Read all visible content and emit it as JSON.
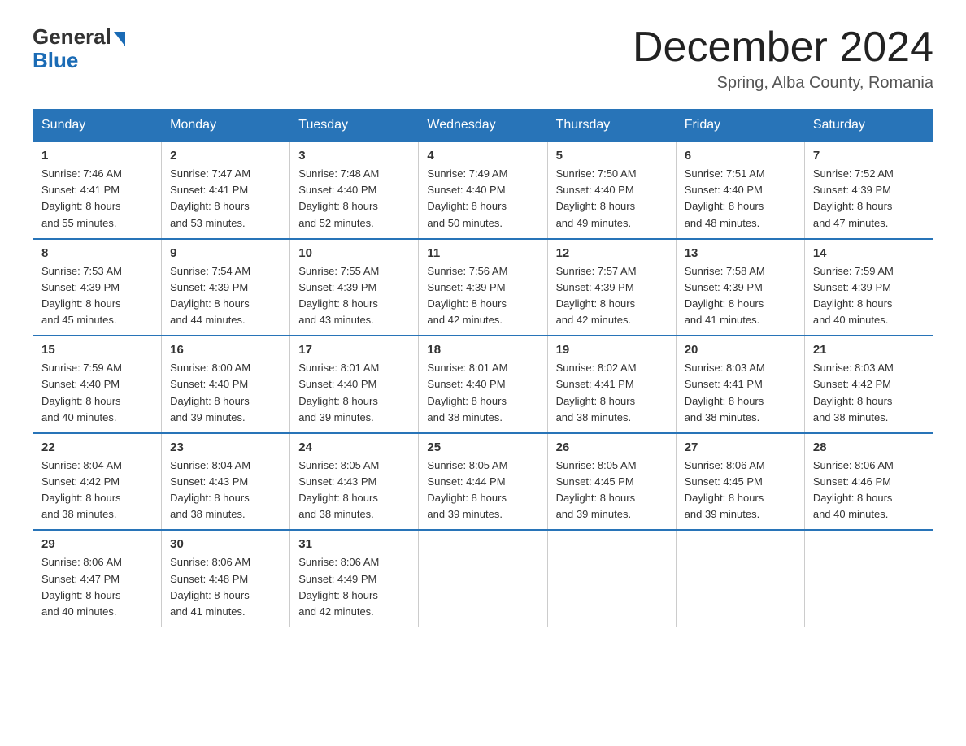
{
  "header": {
    "logo_general": "General",
    "logo_blue": "Blue",
    "month_title": "December 2024",
    "location": "Spring, Alba County, Romania"
  },
  "weekdays": [
    "Sunday",
    "Monday",
    "Tuesday",
    "Wednesday",
    "Thursday",
    "Friday",
    "Saturday"
  ],
  "weeks": [
    [
      {
        "day": "1",
        "sunrise": "7:46 AM",
        "sunset": "4:41 PM",
        "daylight": "8 hours and 55 minutes."
      },
      {
        "day": "2",
        "sunrise": "7:47 AM",
        "sunset": "4:41 PM",
        "daylight": "8 hours and 53 minutes."
      },
      {
        "day": "3",
        "sunrise": "7:48 AM",
        "sunset": "4:40 PM",
        "daylight": "8 hours and 52 minutes."
      },
      {
        "day": "4",
        "sunrise": "7:49 AM",
        "sunset": "4:40 PM",
        "daylight": "8 hours and 50 minutes."
      },
      {
        "day": "5",
        "sunrise": "7:50 AM",
        "sunset": "4:40 PM",
        "daylight": "8 hours and 49 minutes."
      },
      {
        "day": "6",
        "sunrise": "7:51 AM",
        "sunset": "4:40 PM",
        "daylight": "8 hours and 48 minutes."
      },
      {
        "day": "7",
        "sunrise": "7:52 AM",
        "sunset": "4:39 PM",
        "daylight": "8 hours and 47 minutes."
      }
    ],
    [
      {
        "day": "8",
        "sunrise": "7:53 AM",
        "sunset": "4:39 PM",
        "daylight": "8 hours and 45 minutes."
      },
      {
        "day": "9",
        "sunrise": "7:54 AM",
        "sunset": "4:39 PM",
        "daylight": "8 hours and 44 minutes."
      },
      {
        "day": "10",
        "sunrise": "7:55 AM",
        "sunset": "4:39 PM",
        "daylight": "8 hours and 43 minutes."
      },
      {
        "day": "11",
        "sunrise": "7:56 AM",
        "sunset": "4:39 PM",
        "daylight": "8 hours and 42 minutes."
      },
      {
        "day": "12",
        "sunrise": "7:57 AM",
        "sunset": "4:39 PM",
        "daylight": "8 hours and 42 minutes."
      },
      {
        "day": "13",
        "sunrise": "7:58 AM",
        "sunset": "4:39 PM",
        "daylight": "8 hours and 41 minutes."
      },
      {
        "day": "14",
        "sunrise": "7:59 AM",
        "sunset": "4:39 PM",
        "daylight": "8 hours and 40 minutes."
      }
    ],
    [
      {
        "day": "15",
        "sunrise": "7:59 AM",
        "sunset": "4:40 PM",
        "daylight": "8 hours and 40 minutes."
      },
      {
        "day": "16",
        "sunrise": "8:00 AM",
        "sunset": "4:40 PM",
        "daylight": "8 hours and 39 minutes."
      },
      {
        "day": "17",
        "sunrise": "8:01 AM",
        "sunset": "4:40 PM",
        "daylight": "8 hours and 39 minutes."
      },
      {
        "day": "18",
        "sunrise": "8:01 AM",
        "sunset": "4:40 PM",
        "daylight": "8 hours and 38 minutes."
      },
      {
        "day": "19",
        "sunrise": "8:02 AM",
        "sunset": "4:41 PM",
        "daylight": "8 hours and 38 minutes."
      },
      {
        "day": "20",
        "sunrise": "8:03 AM",
        "sunset": "4:41 PM",
        "daylight": "8 hours and 38 minutes."
      },
      {
        "day": "21",
        "sunrise": "8:03 AM",
        "sunset": "4:42 PM",
        "daylight": "8 hours and 38 minutes."
      }
    ],
    [
      {
        "day": "22",
        "sunrise": "8:04 AM",
        "sunset": "4:42 PM",
        "daylight": "8 hours and 38 minutes."
      },
      {
        "day": "23",
        "sunrise": "8:04 AM",
        "sunset": "4:43 PM",
        "daylight": "8 hours and 38 minutes."
      },
      {
        "day": "24",
        "sunrise": "8:05 AM",
        "sunset": "4:43 PM",
        "daylight": "8 hours and 38 minutes."
      },
      {
        "day": "25",
        "sunrise": "8:05 AM",
        "sunset": "4:44 PM",
        "daylight": "8 hours and 39 minutes."
      },
      {
        "day": "26",
        "sunrise": "8:05 AM",
        "sunset": "4:45 PM",
        "daylight": "8 hours and 39 minutes."
      },
      {
        "day": "27",
        "sunrise": "8:06 AM",
        "sunset": "4:45 PM",
        "daylight": "8 hours and 39 minutes."
      },
      {
        "day": "28",
        "sunrise": "8:06 AM",
        "sunset": "4:46 PM",
        "daylight": "8 hours and 40 minutes."
      }
    ],
    [
      {
        "day": "29",
        "sunrise": "8:06 AM",
        "sunset": "4:47 PM",
        "daylight": "8 hours and 40 minutes."
      },
      {
        "day": "30",
        "sunrise": "8:06 AM",
        "sunset": "4:48 PM",
        "daylight": "8 hours and 41 minutes."
      },
      {
        "day": "31",
        "sunrise": "8:06 AM",
        "sunset": "4:49 PM",
        "daylight": "8 hours and 42 minutes."
      },
      null,
      null,
      null,
      null
    ]
  ],
  "labels": {
    "sunrise_label": "Sunrise:",
    "sunset_label": "Sunset:",
    "daylight_label": "Daylight:"
  }
}
